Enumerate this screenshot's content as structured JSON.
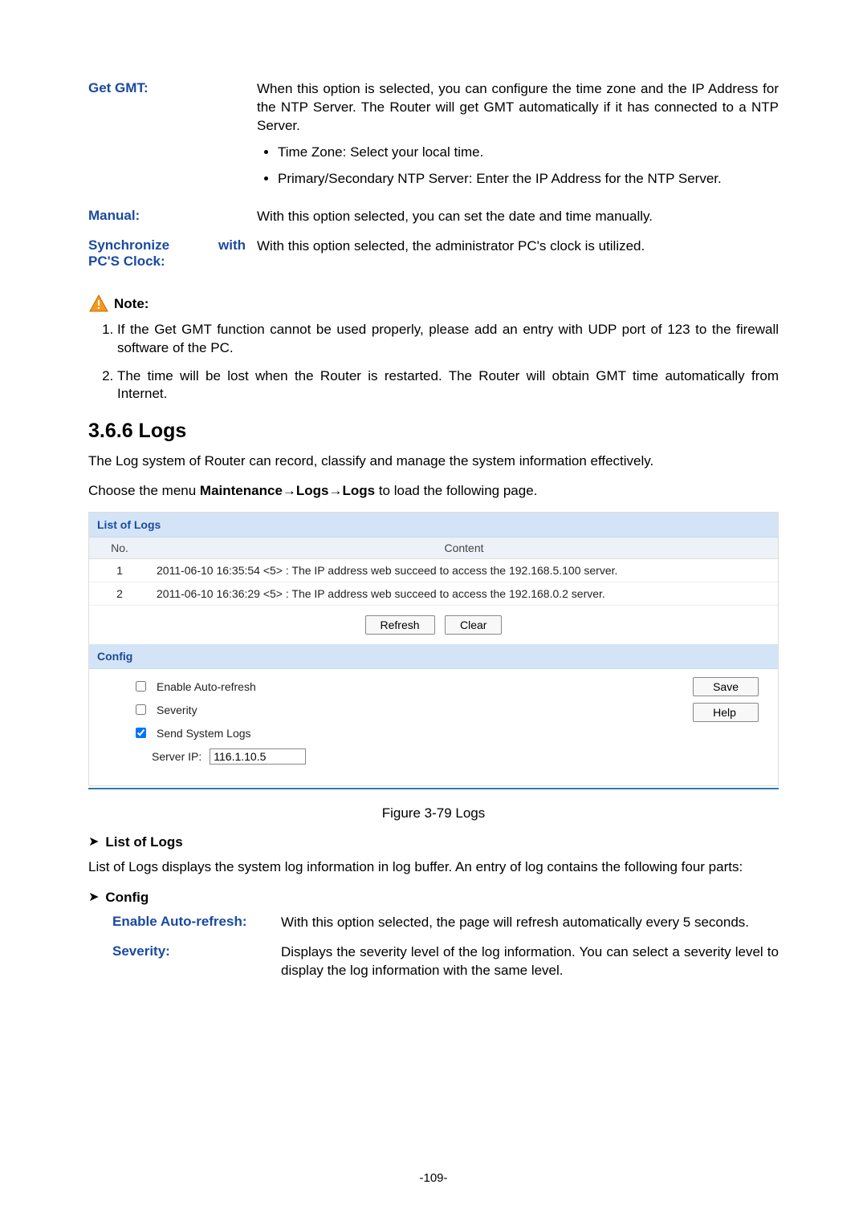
{
  "defs": {
    "get_gmt_label": "Get GMT:",
    "get_gmt_body": "When this option is selected, you can configure the time zone and the IP Address for the NTP Server. The Router will get GMT automatically if it has connected to a NTP Server.",
    "get_gmt_bullets": [
      "Time Zone: Select your local time.",
      "Primary/Secondary NTP Server: Enter the IP Address for the NTP Server."
    ],
    "manual_label": "Manual:",
    "manual_body": "With this option selected, you can set the date and time manually.",
    "sync_label_a": "Synchronize",
    "sync_label_b": "with",
    "sync_label_c": "PC'S Clock:",
    "sync_body": "With this option selected, the administrator PC's clock is utilized."
  },
  "note": {
    "title": "Note:",
    "items": [
      "If the Get GMT function cannot be used properly, please add an entry with UDP port of 123 to the firewall software of the PC.",
      "The time will be lost when the Router is restarted. The Router will obtain GMT time automatically from Internet."
    ]
  },
  "section": {
    "heading": "3.6.6  Logs",
    "intro1": "The Log system of Router can record, classify and manage the system information effectively.",
    "intro2_prefix": "Choose the menu ",
    "intro2_bold": "Maintenance→Logs→Logs",
    "intro2_suffix": " to load the following page."
  },
  "logs_panel": {
    "list_title": "List of Logs",
    "col_no": "No.",
    "col_content": "Content",
    "rows": [
      {
        "no": "1",
        "content": "2011-06-10 16:35:54 <5> : The IP address web succeed to access the 192.168.5.100 server."
      },
      {
        "no": "2",
        "content": "2011-06-10 16:36:29 <5> : The IP address web succeed to access the 192.168.0.2 server."
      }
    ],
    "refresh": "Refresh",
    "clear": "Clear",
    "config_title": "Config",
    "enable_auto": "Enable Auto-refresh",
    "severity": "Severity",
    "send_system_logs": "Send System Logs",
    "server_ip_label": "Server IP:",
    "server_ip_value": "116.1.10.5",
    "save": "Save",
    "help": "Help"
  },
  "figure_caption": "Figure 3-79 Logs",
  "post": {
    "list_heading": "List of Logs",
    "list_body": "List of Logs displays the system log information in log buffer. An entry of log contains the following four parts:",
    "config_heading": "Config",
    "auto_label": "Enable Auto-refresh:",
    "auto_body": "With this option selected, the page will refresh automatically every 5 seconds.",
    "sev_label": "Severity:",
    "sev_body": "Displays the severity level of the log information. You can select a severity level to display the log information with the same level."
  },
  "page_number": "-109-"
}
